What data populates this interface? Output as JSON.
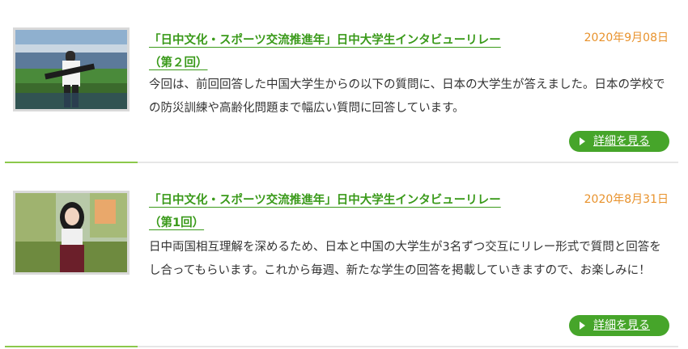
{
  "articles": [
    {
      "title": "「日中文化・スポーツ交流推進年」日中大学生インタビューリレー（第２回）",
      "date": "2020年9月08日",
      "body": "今回は、前回回答した中国大学生からの以下の質問に、日本の大学生が答えました。日本の学校での防災訓練や高齢化問題まで幅広い質問に回答しています。",
      "button_label": "詳細を見る"
    },
    {
      "title": "「日中文化・スポーツ交流推進年」日中大学生インタビューリレー（第1回）",
      "date": "2020年8月31日",
      "body": "日中両国相互理解を深めるため、日本と中国の大学生が3名ずつ交互にリレー形式で質問と回答をし合ってもらいます。これから毎週、新たな学生の回答を掲載していきますので、お楽しみに！",
      "button_label": "詳細を見る"
    }
  ],
  "colors": {
    "title": "#3a9a1a",
    "date": "#e8922c",
    "button": "#46a52a",
    "divider_accent": "#8cc84b"
  }
}
